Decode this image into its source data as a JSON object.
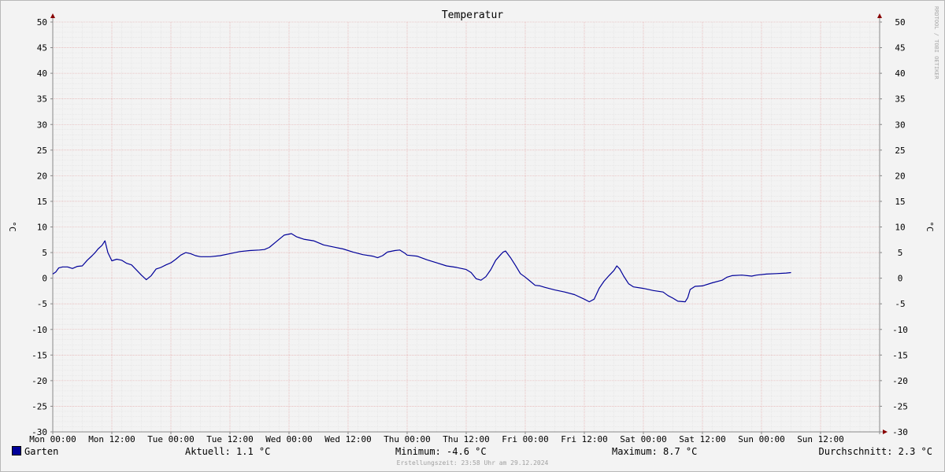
{
  "chart_data": {
    "type": "line",
    "title": "Temperatur",
    "ylabel": "°C",
    "ylabel_right": "°C",
    "watermark": "RRDTOOL / TOBI OETIKER",
    "ylim": [
      -30,
      50
    ],
    "yticks": [
      50,
      45,
      40,
      35,
      30,
      25,
      20,
      15,
      10,
      5,
      0,
      -5,
      -10,
      -15,
      -20,
      -25,
      -30
    ],
    "xlim": [
      0,
      168
    ],
    "xticks": [
      {
        "x": 0,
        "label": "Mon 00:00"
      },
      {
        "x": 12,
        "label": "Mon 12:00"
      },
      {
        "x": 24,
        "label": "Tue 00:00"
      },
      {
        "x": 36,
        "label": "Tue 12:00"
      },
      {
        "x": 48,
        "label": "Wed 00:00"
      },
      {
        "x": 60,
        "label": "Wed 12:00"
      },
      {
        "x": 72,
        "label": "Thu 00:00"
      },
      {
        "x": 84,
        "label": "Thu 12:00"
      },
      {
        "x": 96,
        "label": "Fri 00:00"
      },
      {
        "x": 108,
        "label": "Fri 12:00"
      },
      {
        "x": 120,
        "label": "Sat 00:00"
      },
      {
        "x": 132,
        "label": "Sat 12:00"
      },
      {
        "x": 144,
        "label": "Sun 00:00"
      },
      {
        "x": 156,
        "label": "Sun 12:00"
      }
    ],
    "grid": true,
    "series": [
      {
        "name": "Garten",
        "color": "#000099",
        "points": [
          [
            0,
            0.8
          ],
          [
            0.6,
            1.2
          ],
          [
            1.2,
            2.0
          ],
          [
            2.0,
            2.2
          ],
          [
            3.0,
            2.2
          ],
          [
            4.0,
            1.9
          ],
          [
            5.0,
            2.3
          ],
          [
            6.0,
            2.4
          ],
          [
            7.0,
            3.5
          ],
          [
            8.0,
            4.4
          ],
          [
            8.6,
            5.0
          ],
          [
            9.2,
            5.7
          ],
          [
            10.0,
            6.4
          ],
          [
            10.6,
            7.3
          ],
          [
            11.2,
            5.0
          ],
          [
            12.0,
            3.4
          ],
          [
            13.0,
            3.7
          ],
          [
            14.0,
            3.5
          ],
          [
            15.0,
            2.9
          ],
          [
            16.0,
            2.6
          ],
          [
            17.0,
            1.6
          ],
          [
            18.0,
            0.6
          ],
          [
            19.0,
            -0.3
          ],
          [
            20.0,
            0.5
          ],
          [
            21.0,
            1.8
          ],
          [
            22.0,
            2.1
          ],
          [
            23.0,
            2.6
          ],
          [
            24.0,
            3.0
          ],
          [
            25.0,
            3.7
          ],
          [
            26.0,
            4.5
          ],
          [
            27.0,
            5.0
          ],
          [
            28.0,
            4.8
          ],
          [
            29.0,
            4.4
          ],
          [
            30.0,
            4.2
          ],
          [
            32.0,
            4.2
          ],
          [
            34.0,
            4.4
          ],
          [
            36.0,
            4.8
          ],
          [
            38.0,
            5.2
          ],
          [
            40.0,
            5.4
          ],
          [
            42.0,
            5.5
          ],
          [
            43.0,
            5.6
          ],
          [
            44.0,
            6.0
          ],
          [
            45.5,
            7.2
          ],
          [
            47.0,
            8.4
          ],
          [
            48.5,
            8.7
          ],
          [
            49.5,
            8.1
          ],
          [
            51.0,
            7.6
          ],
          [
            53.0,
            7.3
          ],
          [
            55.0,
            6.5
          ],
          [
            57.0,
            6.1
          ],
          [
            59.0,
            5.7
          ],
          [
            61.0,
            5.1
          ],
          [
            63.0,
            4.6
          ],
          [
            65.0,
            4.3
          ],
          [
            66.0,
            4.0
          ],
          [
            67.0,
            4.4
          ],
          [
            68.0,
            5.1
          ],
          [
            69.5,
            5.4
          ],
          [
            70.5,
            5.5
          ],
          [
            71.5,
            4.9
          ],
          [
            72.0,
            4.5
          ],
          [
            74.0,
            4.3
          ],
          [
            76.0,
            3.6
          ],
          [
            78.0,
            3.0
          ],
          [
            80.0,
            2.4
          ],
          [
            82.0,
            2.1
          ],
          [
            84.0,
            1.7
          ],
          [
            85.0,
            1.1
          ],
          [
            86.0,
            -0.1
          ],
          [
            87.0,
            -0.4
          ],
          [
            88.0,
            0.3
          ],
          [
            89.0,
            1.7
          ],
          [
            90.0,
            3.5
          ],
          [
            91.0,
            4.6
          ],
          [
            91.5,
            5.1
          ],
          [
            92.0,
            5.3
          ],
          [
            93.0,
            4.0
          ],
          [
            94.0,
            2.5
          ],
          [
            95.0,
            0.9
          ],
          [
            96.0,
            0.2
          ],
          [
            97.0,
            -0.6
          ],
          [
            98.0,
            -1.4
          ],
          [
            99.0,
            -1.5
          ],
          [
            100.0,
            -1.8
          ],
          [
            102.0,
            -2.3
          ],
          [
            104.0,
            -2.7
          ],
          [
            106.0,
            -3.2
          ],
          [
            108.0,
            -4.1
          ],
          [
            109.0,
            -4.6
          ],
          [
            110.0,
            -4.1
          ],
          [
            111.0,
            -2.0
          ],
          [
            112.0,
            -0.6
          ],
          [
            113.0,
            0.5
          ],
          [
            114.0,
            1.5
          ],
          [
            114.6,
            2.4
          ],
          [
            115.2,
            1.8
          ],
          [
            116.0,
            0.4
          ],
          [
            117.0,
            -1.1
          ],
          [
            118.0,
            -1.7
          ],
          [
            120.0,
            -2.0
          ],
          [
            122.0,
            -2.4
          ],
          [
            124.0,
            -2.7
          ],
          [
            125.0,
            -3.4
          ],
          [
            126.0,
            -3.9
          ],
          [
            127.0,
            -4.5
          ],
          [
            128.5,
            -4.6
          ],
          [
            129.0,
            -3.8
          ],
          [
            129.5,
            -2.2
          ],
          [
            130.5,
            -1.6
          ],
          [
            132.0,
            -1.5
          ],
          [
            134.0,
            -0.9
          ],
          [
            136.0,
            -0.4
          ],
          [
            137.0,
            0.2
          ],
          [
            138.0,
            0.5
          ],
          [
            140.0,
            0.6
          ],
          [
            142.0,
            0.4
          ],
          [
            143.0,
            0.6
          ],
          [
            145.0,
            0.8
          ],
          [
            147.0,
            0.9
          ],
          [
            149.0,
            1.0
          ],
          [
            150.0,
            1.1
          ]
        ]
      }
    ]
  },
  "legend": {
    "series_name": "Garten",
    "current": "Aktuell: 1.1 °C",
    "minimum": "Minimum: -4.6 °C",
    "maximum": "Maximum: 8.7 °C",
    "average": "Durchschnitt: 2.3 °C"
  },
  "footer": {
    "created": "Erstellungszeit: 23:58 Uhr am 29.12.2024"
  }
}
